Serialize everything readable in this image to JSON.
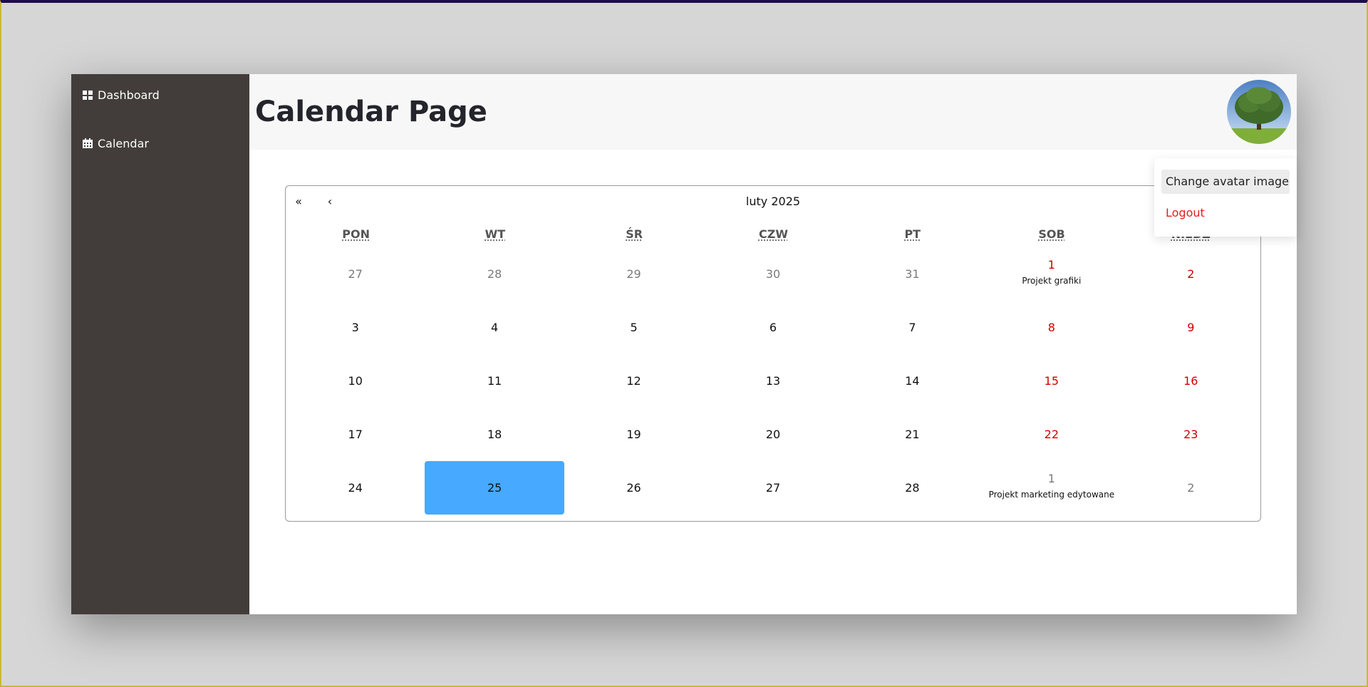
{
  "sidebar": {
    "items": [
      {
        "label": "Dashboard",
        "icon": "dashboard-icon"
      },
      {
        "label": "Calendar",
        "icon": "calendar-icon"
      }
    ]
  },
  "header": {
    "title": "Calendar Page"
  },
  "avatar_menu": {
    "change_avatar": "Change avatar image",
    "logout": "Logout"
  },
  "calendar": {
    "prev_year": "«",
    "prev_month": "‹",
    "month_label": "luty 2025",
    "weekdays": [
      "PON",
      "WT",
      "ŚR",
      "CZW",
      "PT",
      "SOB",
      "NIEDZ"
    ],
    "weeks": [
      [
        {
          "day": "27",
          "type": "outside"
        },
        {
          "day": "28",
          "type": "outside"
        },
        {
          "day": "29",
          "type": "outside"
        },
        {
          "day": "30",
          "type": "outside"
        },
        {
          "day": "31",
          "type": "outside"
        },
        {
          "day": "1",
          "type": "weekend",
          "event": "Projekt grafiki"
        },
        {
          "day": "2",
          "type": "weekend"
        }
      ],
      [
        {
          "day": "3",
          "type": "normal"
        },
        {
          "day": "4",
          "type": "normal"
        },
        {
          "day": "5",
          "type": "normal"
        },
        {
          "day": "6",
          "type": "normal"
        },
        {
          "day": "7",
          "type": "normal"
        },
        {
          "day": "8",
          "type": "weekend"
        },
        {
          "day": "9",
          "type": "weekend"
        }
      ],
      [
        {
          "day": "10",
          "type": "normal"
        },
        {
          "day": "11",
          "type": "normal"
        },
        {
          "day": "12",
          "type": "normal"
        },
        {
          "day": "13",
          "type": "normal"
        },
        {
          "day": "14",
          "type": "normal"
        },
        {
          "day": "15",
          "type": "weekend"
        },
        {
          "day": "16",
          "type": "weekend"
        }
      ],
      [
        {
          "day": "17",
          "type": "normal"
        },
        {
          "day": "18",
          "type": "normal"
        },
        {
          "day": "19",
          "type": "normal"
        },
        {
          "day": "20",
          "type": "normal"
        },
        {
          "day": "21",
          "type": "normal"
        },
        {
          "day": "22",
          "type": "weekend"
        },
        {
          "day": "23",
          "type": "weekend"
        }
      ],
      [
        {
          "day": "24",
          "type": "normal"
        },
        {
          "day": "25",
          "type": "today"
        },
        {
          "day": "26",
          "type": "normal"
        },
        {
          "day": "27",
          "type": "normal"
        },
        {
          "day": "28",
          "type": "normal"
        },
        {
          "day": "1",
          "type": "outside",
          "event": "Projekt marketing edytowane"
        },
        {
          "day": "2",
          "type": "outside"
        }
      ]
    ]
  },
  "colors": {
    "sidebar_bg": "#423d3b",
    "today_highlight": "#47a9ff",
    "weekend_text": "#d10000",
    "logout_text": "#e0201e"
  }
}
